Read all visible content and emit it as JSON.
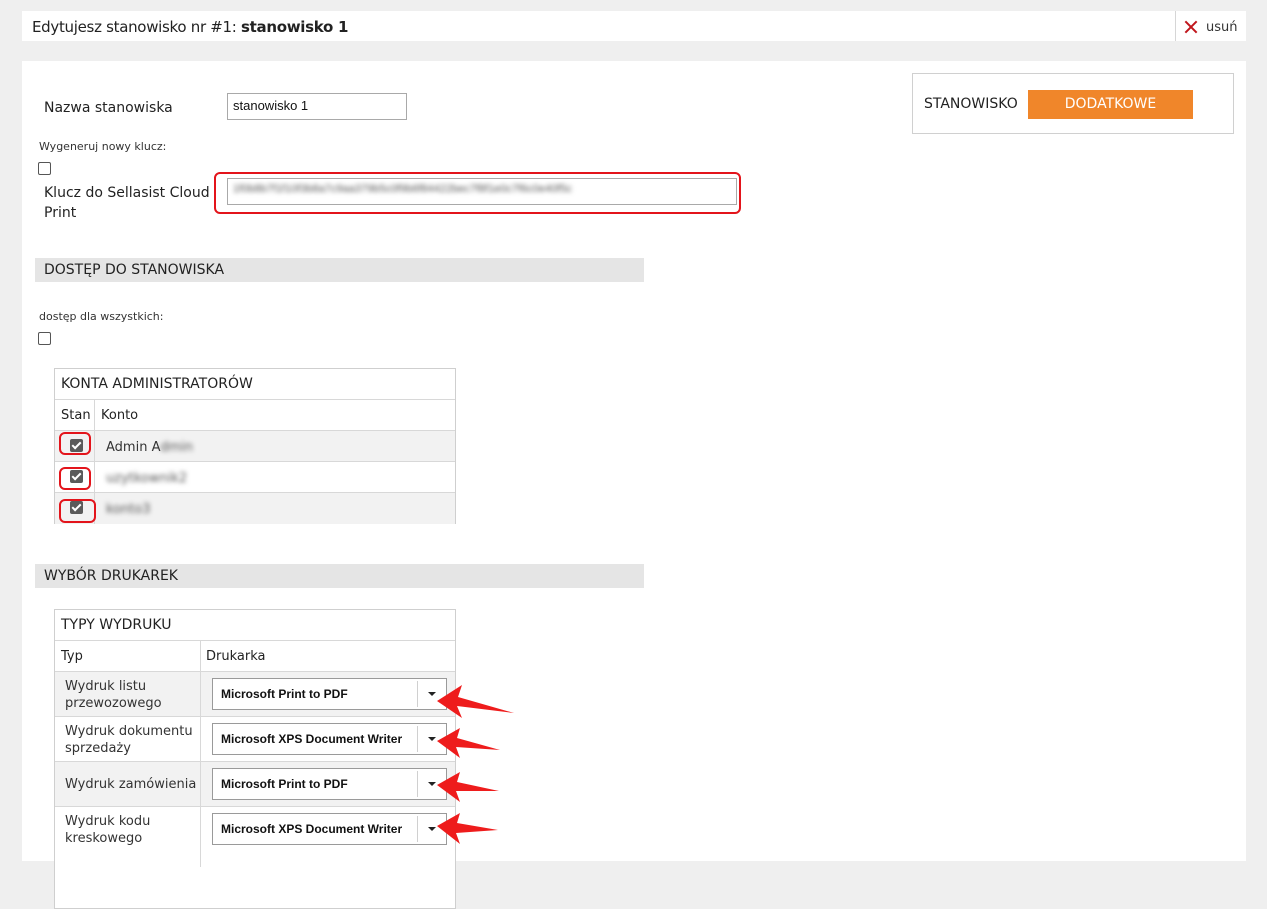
{
  "header": {
    "title_prefix": "Edytujesz stanowisko nr #1: ",
    "title_name": "stanowisko 1",
    "delete_label": "usuń"
  },
  "form": {
    "name_label": "Nazwa stanowiska",
    "name_value": "stanowisko 1",
    "regen_label": "Wygeneruj nowy klucz:",
    "key_label_1": "Klucz do Sellasist Cloud",
    "key_label_2": "Print",
    "key_value": "1f0b8b7f1f10f3b8a7c9aa379b5c0f9b6f84422bec7f8f1e0c7f6c0e40f5c"
  },
  "tabs": {
    "tab1": "STANOWISKO",
    "tab2": "DODATKOWE"
  },
  "access": {
    "section_title": "DOSTĘP DO STANOWISKA",
    "all_label": "dostęp dla wszystkich:",
    "table_title": "KONTA ADMINISTRATORÓW",
    "col_state": "Stan",
    "col_account": "Konto",
    "rows": [
      {
        "account": "Admin A",
        "account_hidden": "dmin"
      },
      {
        "account": "",
        "account_hidden": "uzytkownik2"
      },
      {
        "account": "",
        "account_hidden": "konto3"
      }
    ]
  },
  "printers": {
    "section_title": "WYBÓR DRUKAREK",
    "table_title": "TYPY WYDRUKU",
    "col_type": "Typ",
    "col_printer": "Drukarka",
    "rows": [
      {
        "type_1": "Wydruk listu",
        "type_2": "przewozowego",
        "printer": "Microsoft Print to PDF"
      },
      {
        "type_1": "Wydruk dokumentu",
        "type_2": "sprzedaży",
        "printer": "Microsoft XPS Document Writer"
      },
      {
        "type_1": "Wydruk zamówienia",
        "type_2": "",
        "printer": "Microsoft Print to PDF"
      },
      {
        "type_1": "Wydruk kodu",
        "type_2": "kreskowego",
        "printer": "Microsoft XPS Document Writer"
      }
    ]
  },
  "colors": {
    "accent": "#f0862a",
    "highlight": "#e3141b"
  }
}
